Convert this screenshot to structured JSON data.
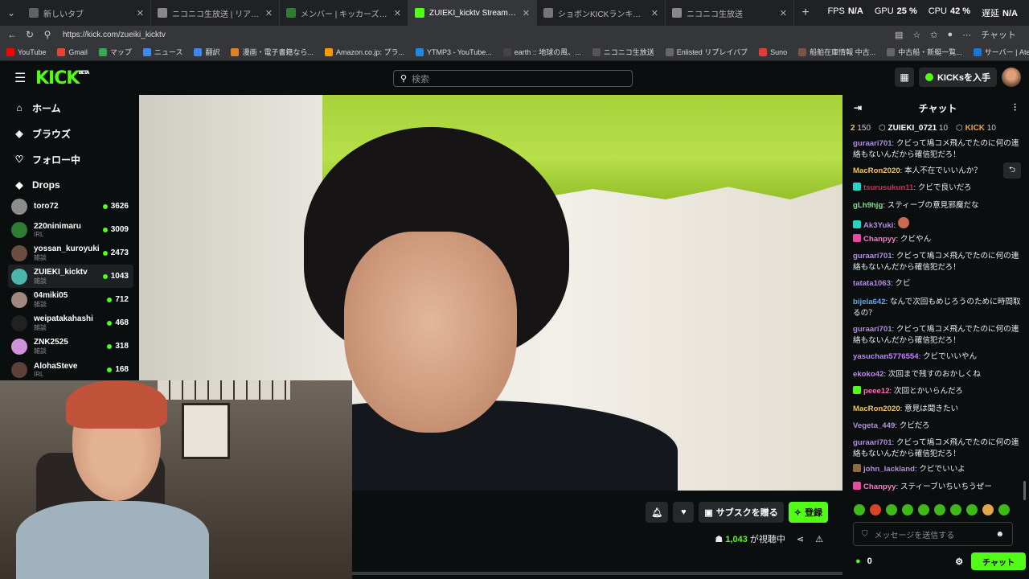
{
  "browser": {
    "tabs": [
      {
        "title": "新しいタブ",
        "color": "#5f6368"
      },
      {
        "title": "ニコニコ生放送 | リアルタイムランキング",
        "color": "#888888"
      },
      {
        "title": "メンバー | キッカーズ公式サイト",
        "color": "#2e7d32"
      },
      {
        "title": "ZUIEKI_kicktv Stream - Watch Live",
        "color": "#53fc18"
      },
      {
        "title": "ショボンKICKランキング | Shobon Kick",
        "color": "#777777"
      },
      {
        "title": "ニコニコ生放送",
        "color": "#888888"
      }
    ],
    "perf": {
      "fps_label": "FPS",
      "fps": "N/A",
      "gpu_label": "GPU",
      "gpu": "25 %",
      "cpu_label": "CPU",
      "cpu": "42 %",
      "lag_label": "遅延",
      "lag": "N/A"
    },
    "url": "https://kick.com/zueiki_kicktv",
    "profile_label": "チャット",
    "bookmarks": [
      {
        "label": "YouTube",
        "color": "#ff0000"
      },
      {
        "label": "Gmail",
        "color": "#ea4335"
      },
      {
        "label": "マップ",
        "color": "#34a853"
      },
      {
        "label": "ニュース",
        "color": "#4285f4"
      },
      {
        "label": "翻訳",
        "color": "#4285f4"
      },
      {
        "label": "漫画・電子書籍なら...",
        "color": "#e67e22"
      },
      {
        "label": "Amazon.co.jp: プラ...",
        "color": "#ff9900"
      },
      {
        "label": "YTMP3 - YouTube...",
        "color": "#1e88e5"
      },
      {
        "label": "earth :: 地球の風、...",
        "color": "#444444"
      },
      {
        "label": "ニコニコ生放送",
        "color": "#555555"
      },
      {
        "label": "Enlisted リプレイバブ",
        "color": "#666666"
      },
      {
        "label": "Suno",
        "color": "#e53935"
      },
      {
        "label": "船舶在庫情報 中古...",
        "color": "#795548"
      },
      {
        "label": "中古船・新艇一覧...",
        "color": "#666666"
      },
      {
        "label": "サーバー | Aternos |...",
        "color": "#1976d2"
      }
    ]
  },
  "header": {
    "logo": "KICK",
    "logo_tag": "BETA",
    "search_placeholder": "検索",
    "get_kicks": "KICKsを入手"
  },
  "sidebar": {
    "nav": [
      {
        "label": "ホーム",
        "icon": "home-icon",
        "glyph": "⌂"
      },
      {
        "label": "ブラウズ",
        "icon": "browse-icon",
        "glyph": "◈"
      },
      {
        "label": "フォロー中",
        "icon": "heart-icon",
        "glyph": "♡"
      },
      {
        "label": "Drops",
        "icon": "drops-icon",
        "glyph": "◆"
      }
    ],
    "channels": [
      {
        "name": "toro72",
        "category": "",
        "viewers": "3626",
        "color": "#8c8c8c"
      },
      {
        "name": "220ninimaru",
        "category": "IRL",
        "viewers": "3009",
        "color": "#2e7d32"
      },
      {
        "name": "yossan_kuroyuki",
        "category": "雑談",
        "viewers": "2473",
        "color": "#6d4c41"
      },
      {
        "name": "ZUIEKI_kicktv",
        "category": "雑談",
        "viewers": "1043",
        "color": "#4db6ac"
      },
      {
        "name": "04miki05",
        "category": "雑談",
        "viewers": "712",
        "color": "#a1887f"
      },
      {
        "name": "weipatakahashi",
        "category": "雑談",
        "viewers": "468",
        "color": "#212121"
      },
      {
        "name": "ZNK2525",
        "category": "雑談",
        "viewers": "318",
        "color": "#ce93d8"
      },
      {
        "name": "AlohaSteve",
        "category": "IRL",
        "viewers": "168",
        "color": "#5d4037"
      }
    ]
  },
  "stream": {
    "subscribe_label": "サブスクを贈る",
    "follow_label": "登録",
    "viewers": "1,043",
    "viewers_suffix": "が視聴中"
  },
  "chat": {
    "title": "チャット",
    "pinned": [
      {
        "rank": "2",
        "name": "",
        "count": "150"
      },
      {
        "rank": "",
        "name": "ZUIEKI_0721",
        "count": "10"
      },
      {
        "rank": "",
        "name": "KICK",
        "count": "10"
      }
    ],
    "messages": [
      {
        "user": "guraari701",
        "color": "#b48ede",
        "text": "クビって鳩コメ飛んでたのに何の連絡もないんだから確信犯だろ！"
      },
      {
        "user": "MacRon2020",
        "color": "#f0c36a",
        "text": "本人不在でいいんか？"
      },
      {
        "user": "tsurusukun11",
        "color": "#e0245e",
        "text": "クビで良いだろ"
      },
      {
        "user": "gLh9hjg",
        "color": "#7ee08a",
        "text": "スティーブの意見邪魔だな"
      },
      {
        "user": "Ak3Yuki",
        "color": "#b48ede",
        "text": ""
      },
      {
        "user": "Chanpyy",
        "color": "#ff7ac6",
        "text": "クビやん"
      },
      {
        "user": "guraari701",
        "color": "#b48ede",
        "text": "クビって鳩コメ飛んでたのに何の連絡もないんだから確信犯だろ！"
      },
      {
        "user": "tatata1063",
        "color": "#b48ede",
        "text": "クビ"
      },
      {
        "user": "bijela642",
        "color": "#60a5fa",
        "text": "なんで次回もめじろうのために時間取るの？"
      },
      {
        "user": "guraari701",
        "color": "#b48ede",
        "text": "クビって鳩コメ飛んでたのに何の連絡もないんだから確信犯だろ！"
      },
      {
        "user": "yasuchan5776554",
        "color": "#c084fc",
        "text": "クビでいいやん"
      },
      {
        "user": "ekoko42",
        "color": "#c084fc",
        "text": "次回まで残すのおかしくね"
      },
      {
        "user": "peee12",
        "color": "#f472b6",
        "text": "次回とかいらんだろ"
      },
      {
        "user": "MacRon2020",
        "color": "#f0c36a",
        "text": "意見は聞きたい"
      },
      {
        "user": "Vegeta_449",
        "color": "#b48ede",
        "text": "クビだろ"
      },
      {
        "user": "guraari701",
        "color": "#b48ede",
        "text": "クビって鳩コメ飛んでたのに何の連絡もないんだから確信犯だろ！"
      },
      {
        "user": "john_lackland",
        "color": "#b48ede",
        "text": "クビでいいよ"
      },
      {
        "user": "Chanpyy",
        "color": "#ff7ac6",
        "text": "スティーブいちいちうぜー"
      }
    ],
    "input_placeholder": "メッセージを送信する",
    "kicks_balance": "0",
    "send_label": "チャット"
  }
}
